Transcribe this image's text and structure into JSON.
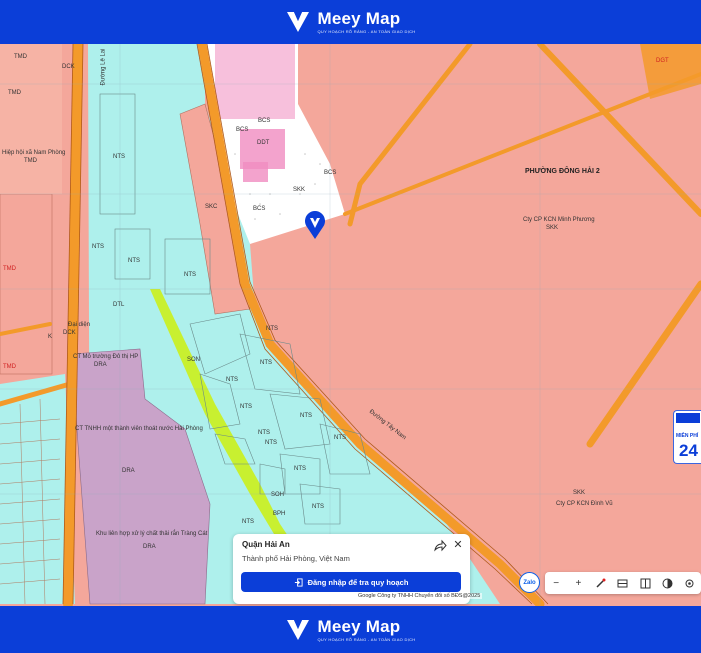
{
  "app": {
    "brand_name": "Meey Map",
    "brand_tagline": "QUY HOẠCH RÕ RÀNG - AN TOÀN GIAO DỊCH"
  },
  "map": {
    "labels": {
      "tmd1": "TMD",
      "tmd2": "TMD",
      "dck_top": "DCK",
      "duong_left": "Đường Lê Lai",
      "hiep_hoi": "Hiệp hội xã Nam Phòng",
      "tmd3": "TMD",
      "nts1": "NTS",
      "nts2": "NTS",
      "tmd_red": "TMD",
      "dtl": "DTL",
      "nts3": "NTS",
      "nts4": "NTS",
      "dai_dien": "Đại diện",
      "dck": "DCK",
      "k": "K",
      "tmd_red2": "TMD",
      "ct_mi": "CT Mỏ trường Đô thị HP",
      "dra1": "DRA",
      "ct_tnhh": "CT TNHH một thành viên thoát nước Hải Phòng",
      "dra2": "DRA",
      "khu_lien": "Khu liên hợp xử lý chất thải rắn Tràng Cát",
      "dra3": "DRA",
      "skc": "SKC",
      "nts5": "NTS",
      "nts6": "NTS",
      "son": "SON",
      "nts7": "NTS",
      "nts8": "NTS",
      "nts9": "NTS",
      "nts10": "NTS",
      "nts11": "NTS",
      "nts12": "NTS",
      "nts13": "NTS",
      "nts14": "NTS",
      "nts15": "NTS",
      "soh": "SOH",
      "bph": "BPH",
      "bcs1": "BCS",
      "bcs2": "BCS",
      "bcs3": "BCS",
      "bcs4": "BCS",
      "ddt": "DDT",
      "skk_small": "SKK",
      "dgt": "DGT",
      "phuong": "PHƯỜNG ĐÔNG HẢI 2",
      "cty_minh": "Cty CP KCN Minh Phương",
      "skk1": "SKK",
      "duong_tay": "Đường Tây Nam",
      "skk2": "SKK",
      "cty_dinh": "Cty CP KCN Đình Vũ"
    }
  },
  "info_card": {
    "title": "Quận Hải An",
    "subtitle": "Thành phố Hải Phòng, Việt Nam",
    "login_button": "Đăng nhập để tra quy hoạch"
  },
  "attribution": {
    "google": "Google",
    "copyright": "Công ty TNHH Chuyển đổi số BĐS@2025"
  },
  "zalo_label": "Zalo",
  "side_badge": {
    "label": "MIỄN PHÍ",
    "number": "24"
  },
  "toolbar": {
    "items": [
      "minus-icon",
      "plus-icon",
      "compass-icon",
      "layers-icon",
      "split-icon",
      "palette-icon",
      "locate-icon"
    ]
  },
  "colors": {
    "brand": "#0b3ed8",
    "residential": "#f4a79b",
    "water": "#aef0ec",
    "road": "#f39a2a",
    "industrial": "#f4a79b",
    "waste": "#c9a3c9",
    "green_strip": "#c8f030"
  }
}
